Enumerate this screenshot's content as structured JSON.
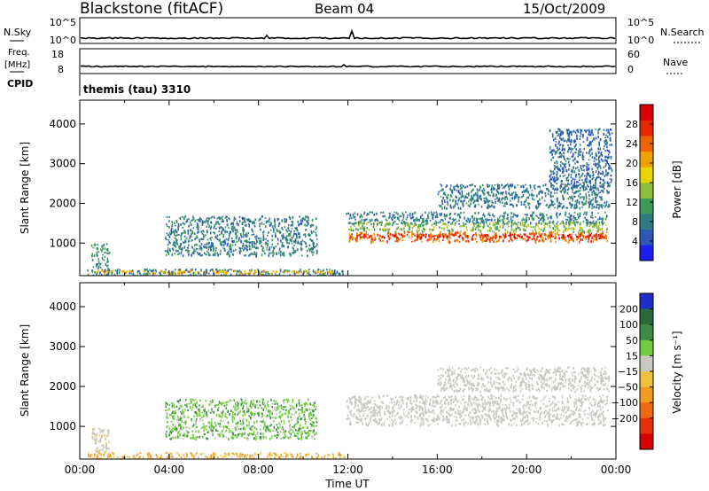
{
  "header": {
    "title": "Blackstone (fitACF)",
    "beam": "Beam 04",
    "date": "15/Oct/2009"
  },
  "strips": {
    "nsky_label": "N.Sky",
    "nsky_ticks": [
      "10^5",
      "10^0"
    ],
    "nsearch_label": "N.Search",
    "nsearch_ticks": [
      "10^5",
      "10^0"
    ],
    "freq_label": "Freq.",
    "freq_unit": "[MHz]",
    "freq_ticks": [
      "18",
      "8"
    ],
    "nave_label": "Nave",
    "nave_ticks": [
      "60",
      "0"
    ],
    "cpid_label": "CPID",
    "cpid_text": "themis (tau) 3310"
  },
  "chart_data": [
    {
      "type": "heatmap",
      "name": "power",
      "ylabel": "Slant Range [km]",
      "yticks": [
        1000,
        2000,
        3000,
        4000
      ],
      "ylim": [
        180,
        4600
      ],
      "xlim": [
        0,
        24
      ],
      "colorbar": {
        "label": "Power [dB]",
        "ticks": [
          "4",
          "8",
          "12",
          "16",
          "20",
          "24",
          "28"
        ],
        "colors": [
          "#1e1ef0",
          "#2a57b8",
          "#2f7a85",
          "#3a9a5a",
          "#8dbe3a",
          "#e9d400",
          "#f2a000",
          "#ee6400",
          "#e82800",
          "#d80000"
        ]
      },
      "bands": [
        {
          "t0": 0.5,
          "t1": 1.3,
          "r0": 300,
          "r1": 1000,
          "value": 10
        },
        {
          "t0": 0.3,
          "t1": 11.9,
          "r0": 180,
          "r1": 360,
          "value": 8
        },
        {
          "t0": 0.7,
          "t1": 11.5,
          "r0": 250,
          "r1": 330,
          "value": 20
        },
        {
          "t0": 3.8,
          "t1": 10.6,
          "r0": 700,
          "r1": 1700,
          "value": 8
        },
        {
          "t0": 11.9,
          "t1": 23.6,
          "r0": 1500,
          "r1": 1800,
          "value": 8
        },
        {
          "t0": 12.0,
          "t1": 23.6,
          "r0": 1300,
          "r1": 1550,
          "value": 14
        },
        {
          "t0": 12.0,
          "t1": 23.6,
          "r0": 1050,
          "r1": 1300,
          "value": 24
        },
        {
          "t0": 12.0,
          "t1": 23.6,
          "r0": 1150,
          "r1": 1250,
          "value": 28
        },
        {
          "t0": 16.0,
          "t1": 23.7,
          "r0": 1900,
          "r1": 2500,
          "value": 8
        },
        {
          "t0": 21.0,
          "t1": 23.8,
          "r0": 2400,
          "r1": 3900,
          "value": 6
        }
      ]
    },
    {
      "type": "heatmap",
      "name": "velocity",
      "xlabel": "Time UT",
      "ylabel": "Slant Range [km]",
      "xticks": [
        "00:00",
        "04:00",
        "08:00",
        "12:00",
        "16:00",
        "20:00",
        "00:00"
      ],
      "yticks": [
        1000,
        2000,
        3000,
        4000
      ],
      "ylim": [
        180,
        4600
      ],
      "xlim": [
        0,
        24
      ],
      "colorbar": {
        "label": "Velocity [m s⁻¹]",
        "ticks": [
          "200",
          "100",
          "50",
          "15",
          "−15",
          "−50",
          "−100",
          "−200"
        ],
        "colors": [
          "#1e2ec8",
          "#2a6a3a",
          "#3c8c46",
          "#6fcc3c",
          "#c8c8c0",
          "#f0c040",
          "#f09a20",
          "#ee6a10",
          "#e83008",
          "#d80000"
        ]
      },
      "bands": [
        {
          "t0": 0.5,
          "t1": 1.3,
          "r0": 300,
          "r1": 1000,
          "value": -5
        },
        {
          "t0": 0.3,
          "t1": 11.9,
          "r0": 180,
          "r1": 360,
          "value": -30
        },
        {
          "t0": 3.8,
          "t1": 10.6,
          "r0": 700,
          "r1": 1700,
          "value": 25
        },
        {
          "t0": 11.9,
          "t1": 23.6,
          "r0": 1050,
          "r1": 1800,
          "value": 0
        },
        {
          "t0": 16.0,
          "t1": 23.7,
          "r0": 1900,
          "r1": 2500,
          "value": 0
        }
      ]
    }
  ]
}
